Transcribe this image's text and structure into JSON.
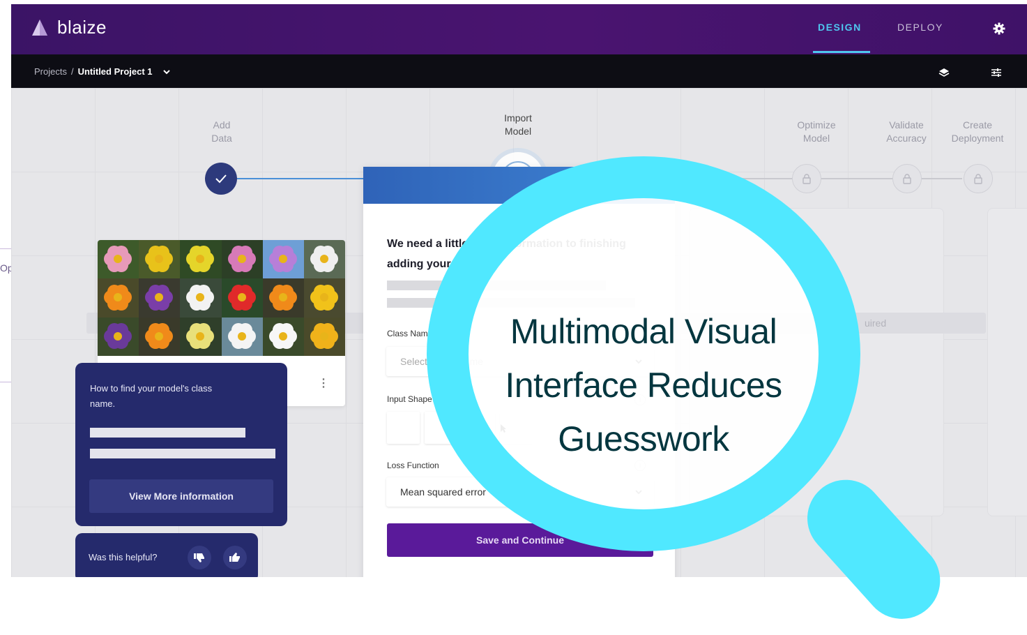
{
  "app": {
    "logo_text": "blaize"
  },
  "nav": {
    "design": "DESIGN",
    "deploy": "DEPLOY"
  },
  "breadcrumb": {
    "root": "Projects",
    "separator": "/",
    "current": "Untitled Project 1"
  },
  "stepper": {
    "steps": [
      {
        "label_line1": "Add",
        "label_line2": "Data",
        "state": "done"
      },
      {
        "label_line1": "Import",
        "label_line2": "Model",
        "state": "current",
        "badge": "a"
      },
      {
        "label_line1": "Optimize",
        "label_line2": "Model",
        "state": "locked"
      },
      {
        "label_line1": "Validate",
        "label_line2": "Accuracy",
        "state": "locked"
      },
      {
        "label_line1": "Create",
        "label_line2": "Deployment",
        "state": "locked"
      }
    ]
  },
  "background_card": {
    "text": "uired"
  },
  "form": {
    "title": "We need a little more information to finishing adding your model.",
    "class_name_label": "Class Name",
    "class_name_placeholder": "Select Class Name",
    "input_shape_label": "Input Shape",
    "loss_function_label": "Loss Function",
    "loss_function_value": "Mean squared error",
    "save_label": "Save and Continue"
  },
  "help": {
    "title": "How to find your model's class name.",
    "button": "View More information",
    "feedback_question": "Was this helpful?"
  },
  "overlay": {
    "headline_line1": "Multimodal Visual",
    "headline_line2": "Interface Reduces",
    "headline_line3": "Guesswork"
  },
  "edge": {
    "text": "Op"
  },
  "colors": {
    "header": "#4a1470",
    "accent": "#4fc7ef",
    "primary_button": "#5a1a9a",
    "help_card": "#252a6c",
    "magnifier": "#50e8ff",
    "headline": "#04363f"
  },
  "icons": [
    "logo-icon",
    "gear-icon",
    "chevron-down-icon",
    "layers-icon",
    "sliders-icon",
    "check-icon",
    "lock-icon",
    "info-icon",
    "kebab-icon",
    "thumbs-down-icon",
    "thumbs-up-icon",
    "cursor-icon",
    "magnifier-icon"
  ]
}
